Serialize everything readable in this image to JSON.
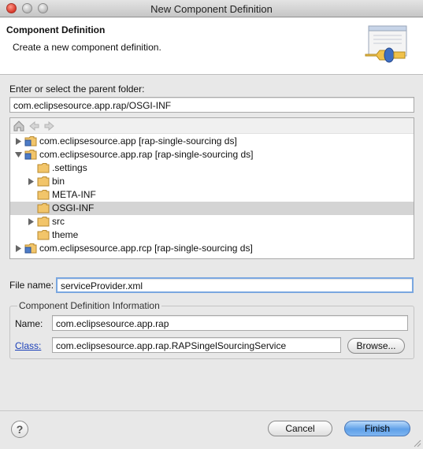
{
  "window": {
    "title": "New Component Definition"
  },
  "banner": {
    "title": "Component Definition",
    "description": "Create a new component definition.",
    "icon": "component-wizard-icon"
  },
  "parent_folder": {
    "label": "Enter or select the parent folder:",
    "value": "com.eclipsesource.app.rap/OSGI-INF"
  },
  "tree_toolbar": {
    "icons": [
      "home-icon",
      "back-arrow-icon",
      "forward-arrow-icon"
    ]
  },
  "tree": [
    {
      "label": "com.eclipsesource.app [rap-single-sourcing ds]",
      "level": 0,
      "twisty": "collapsed",
      "icon": "project-icon"
    },
    {
      "label": "com.eclipsesource.app.rap [rap-single-sourcing ds]",
      "level": 0,
      "twisty": "expanded",
      "icon": "project-icon"
    },
    {
      "label": ".settings",
      "level": 1,
      "twisty": "none",
      "icon": "folder-icon"
    },
    {
      "label": "bin",
      "level": 1,
      "twisty": "collapsed",
      "icon": "folder-icon"
    },
    {
      "label": "META-INF",
      "level": 1,
      "twisty": "none",
      "icon": "folder-icon"
    },
    {
      "label": "OSGI-INF",
      "level": 1,
      "twisty": "none",
      "icon": "folder-icon",
      "selected": true
    },
    {
      "label": "src",
      "level": 1,
      "twisty": "collapsed",
      "icon": "folder-icon"
    },
    {
      "label": "theme",
      "level": 1,
      "twisty": "none",
      "icon": "folder-icon"
    },
    {
      "label": "com.eclipsesource.app.rcp [rap-single-sourcing ds]",
      "level": 0,
      "twisty": "collapsed",
      "icon": "project-icon"
    }
  ],
  "file_name": {
    "label": "File name:",
    "value": "serviceProvider.xml"
  },
  "info_group": {
    "title": "Component Definition Information",
    "name_label": "Name:",
    "name_value": "com.eclipsesource.app.rap",
    "class_label": "Class:",
    "class_value": "com.eclipsesource.app.rap.RAPSingelSourcingService",
    "browse_label": "Browse..."
  },
  "footer": {
    "help_icon": "help-icon",
    "help_glyph": "?",
    "cancel_label": "Cancel",
    "finish_label": "Finish"
  },
  "colors": {
    "selection": "#d4d4d4",
    "link": "#1a3fb8",
    "default_button": "#5fa0e8",
    "close_button": "#d8372a"
  }
}
